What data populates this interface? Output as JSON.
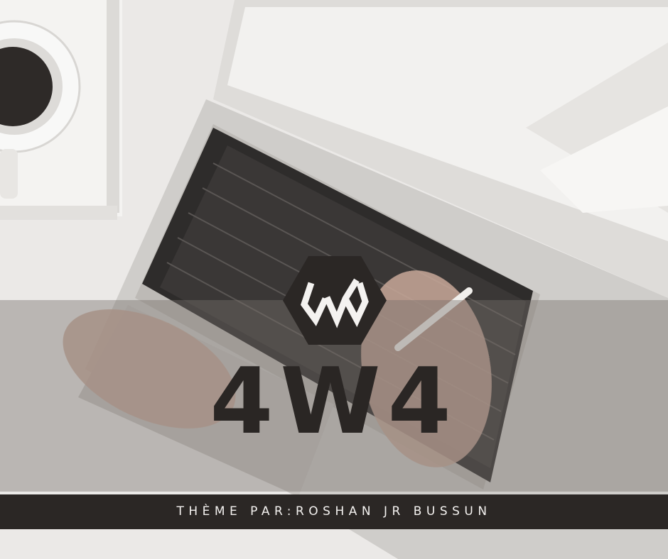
{
  "title": "4W4",
  "credit": "THÈME PAR:ROSHAN JR BUSSUN",
  "logo_icon": "hexagon-4w4-logo-icon",
  "colors": {
    "background": "#eceae8",
    "dark": "#2b2725",
    "band": "#78706c",
    "light_text": "#f4f2f0"
  }
}
